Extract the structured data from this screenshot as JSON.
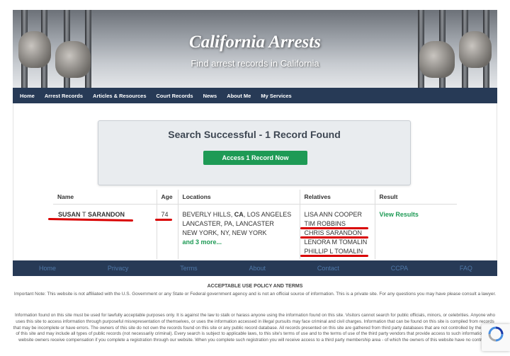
{
  "header": {
    "title": "California Arrests",
    "subtitle": "Find arrest records in California"
  },
  "nav": {
    "items": [
      "Home",
      "Arrest Records",
      "Articles & Resources",
      "Court Records",
      "News",
      "About Me",
      "My Services"
    ]
  },
  "search": {
    "title": "Search Successful - 1 Record Found",
    "button_label": "Access 1 Record Now"
  },
  "results": {
    "headers": [
      "Name",
      "Age",
      "Locations",
      "Relatives",
      "Result"
    ],
    "row": {
      "name_first": "SUSAN",
      "name_middle": "T",
      "name_last": "SARANDON",
      "age": "74",
      "location_line1_a": "BEVERLY HILLS, ",
      "location_line1_b": "CA",
      "location_line1_c": ", LOS ANGELES",
      "location_line2": "LANCASTER, PA, LANCASTER",
      "location_line3": "NEW YORK, NY, NEW YORK",
      "more_link": "and 3 more...",
      "relatives": [
        "LISA ANN COOPER",
        "TIM ROBBINS",
        "CHRIS SARANDON",
        "LENORA M TOMALIN",
        "PHILLIP L TOMALIN"
      ],
      "result_link": "View Results"
    }
  },
  "footer_nav": {
    "items": [
      "Home",
      "Privacy",
      "Terms",
      "About",
      "Contact",
      "CCPA",
      "FAQ"
    ]
  },
  "policy": {
    "title": "ACCEPTABLE USE POLICY AND TERMS",
    "note": "Important Note: This website is not affiliated with the U.S. Government or any State or Federal government agency and is not an official source of information. This is a private site. For any questions you may have please consult a lawyer.",
    "body": "Information found on this site must be used for lawfully acceptable purposes only. It is against the law to stalk or harass anyone using the information found on this site. Visitors cannot search for public officials, minors, or celebrities. Anyone who uses this site to access information through purposeful misrepresentation of themselves, or uses the information accessed in illegal pursuits may face criminal and civil charges. Information that can be found on this site is compiled from records that may be incomplete or have errors. The owners of this site do not own the records found on this site or any public record database. All records presented on this site are gathered from third party databases that are not controlled by the owners of this site and may include all types of public records (not necessarily criminal). Every search is subject to applicable laws, to this site's terms of use and to the terms of use of the third party vendors that provide access to such information. The website owners receive compensation if you complete a registration through our website. When you complete such registration you will receive access to a third party membership area - of which the owners of this website have no control of."
  },
  "colors": {
    "nav_bg": "#273a56",
    "accent_green": "#1e9a55",
    "annotation_red": "#d90000"
  }
}
